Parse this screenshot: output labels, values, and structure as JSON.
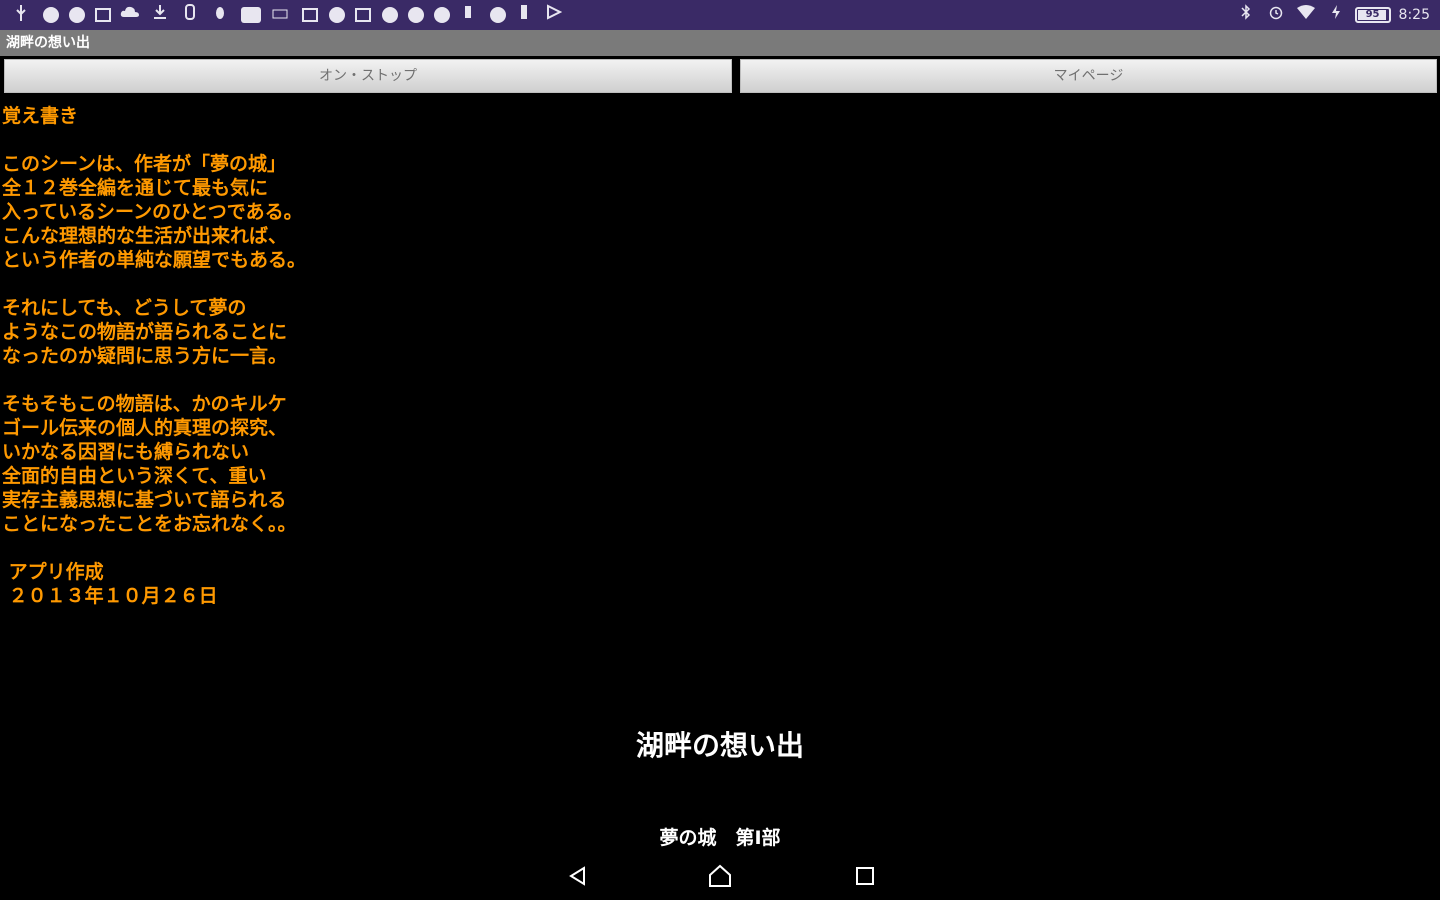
{
  "status_bar": {
    "left_icons": [
      "usb-icon",
      "app-icon",
      "app-icon",
      "app-icon",
      "cloud-icon",
      "download-icon",
      "app-icon",
      "bug-icon",
      "app-icon",
      "keyboard-icon",
      "app-icon",
      "app-icon",
      "app-icon",
      "app-icon",
      "app-icon",
      "info-icon",
      "app-icon",
      "info-icon",
      "app-icon",
      "play-icon"
    ],
    "right_icons": [
      "bluetooth-icon",
      "alarm-icon",
      "wifi-icon",
      "charging-icon"
    ],
    "battery": "95",
    "battery_level": 0.95,
    "time": "8:25",
    "color": "#3a2a66"
  },
  "app": {
    "title": "湖畔の想い出"
  },
  "buttons": {
    "left_label": "オン・ストップ",
    "right_label": "マイページ"
  },
  "memo": {
    "color": "#ff9900",
    "paragraphs": [
      [
        "覚え書き"
      ],
      [
        "このシーンは、作者が「夢の城」",
        "全１２巻全編を通じて最も気に",
        "入っているシーンのひとつである。",
        "こんな理想的な生活が出来れば、",
        "という作者の単純な願望でもある。"
      ],
      [
        "それにしても、どうして夢の",
        "ようなこの物語が語られることに",
        "なったのか疑問に思う方に一言。"
      ],
      [
        "そもそもこの物語は、かのキルケ",
        "ゴール伝来の個人的真理の探究、",
        "いかなる因習にも縛られない",
        "全面的自由という深くて、重い",
        "実存主義思想に基づいて語られる",
        "ことになったことをお忘れなく。。"
      ],
      [
        " アプリ作成",
        " ２０１３年１０月２６日"
      ]
    ]
  },
  "overlay": {
    "title": "湖畔の想い出",
    "subtitle": "夢の城　第Ⅰ部"
  },
  "nav": {
    "back": "back-icon",
    "home": "home-icon",
    "recent": "recent-apps-icon"
  }
}
